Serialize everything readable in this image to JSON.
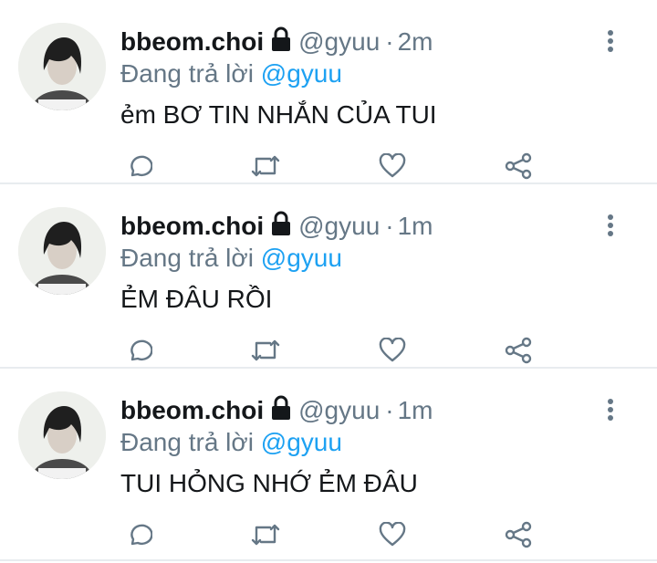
{
  "colors": {
    "text": "#14171a",
    "secondary": "#657786",
    "link": "#1da1f2",
    "divider": "#e8ecef"
  },
  "icons": {
    "lock": "lock-icon",
    "more": "more-vertical-icon",
    "reply": "reply-icon",
    "retweet": "retweet-icon",
    "like": "heart-icon",
    "share": "share-icon"
  },
  "tweets": [
    {
      "display_name": "bbeom.choi",
      "handle": "@gyuu",
      "separator": "·",
      "time": "2m",
      "reply_prefix": "Đang trả lời",
      "reply_to": "@gyuu",
      "text": "ẻm BƠ TIN NHẮN CỦA TUI"
    },
    {
      "display_name": "bbeom.choi",
      "handle": "@gyuu",
      "separator": "·",
      "time": "1m",
      "reply_prefix": "Đang trả lời",
      "reply_to": "@gyuu",
      "text": "ẺM ĐÂU RỒI"
    },
    {
      "display_name": "bbeom.choi",
      "handle": "@gyuu",
      "separator": "·",
      "time": "1m",
      "reply_prefix": "Đang trả lời",
      "reply_to": "@gyuu",
      "text": "TUI HỎNG NHỚ ẺM ĐÂU"
    }
  ]
}
